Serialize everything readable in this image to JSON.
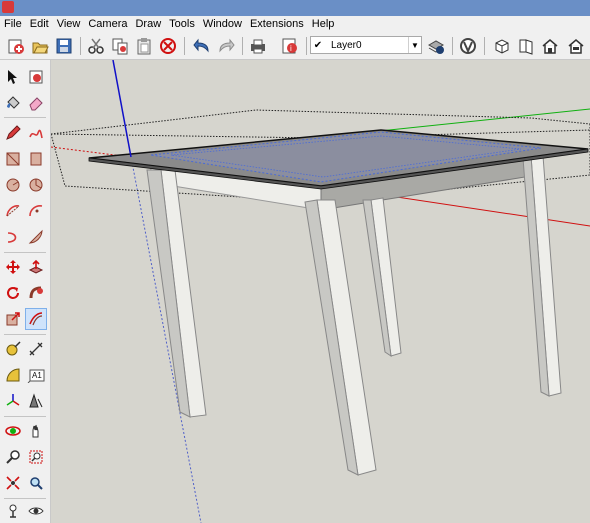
{
  "menu": {
    "items": [
      "File",
      "Edit",
      "View",
      "Camera",
      "Draw",
      "Tools",
      "Window",
      "Extensions",
      "Help"
    ]
  },
  "layer": {
    "current": "Layer0"
  },
  "left_toolbar": {
    "text_tool_glyph": "A1"
  },
  "colors": {
    "viewport_bg": "#d6d5ce",
    "red_axis": "#d01010",
    "green_axis": "#10b010",
    "blue_axis": "#1010c8",
    "table_top": "#8a8a8a",
    "selection_blue": "#4a6bd8"
  },
  "icons": [
    "sketchup-icon",
    "new-icon",
    "open-icon",
    "save-icon",
    "cut-icon",
    "copy-icon",
    "paste-icon",
    "erase-icon",
    "undo-icon",
    "redo-icon",
    "print-icon",
    "model-info-icon",
    "layer-manager-icon",
    "warehouse-icon",
    "share-icon",
    "home-icon",
    "select-icon",
    "paint-bucket-icon",
    "eraser-icon",
    "pencil-icon"
  ]
}
